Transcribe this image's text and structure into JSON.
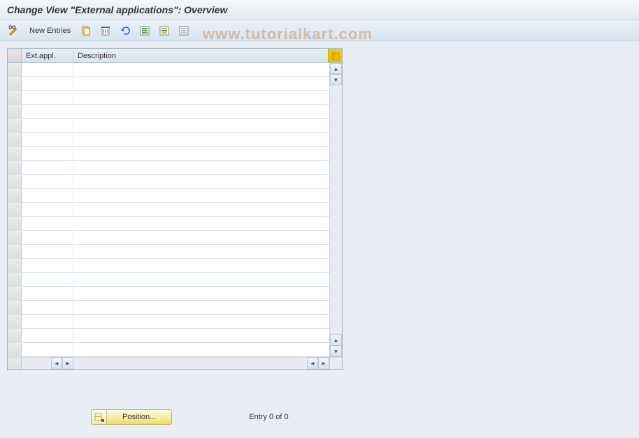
{
  "title": "Change View \"External applications\": Overview",
  "toolbar": {
    "new_entries_label": "New Entries"
  },
  "table": {
    "columns": {
      "col1": "Ext.appl.",
      "col2": "Description"
    },
    "row_count": 21
  },
  "footer": {
    "position_label": "Position...",
    "entry_text": "Entry 0 of 0"
  },
  "watermark": "www.tutorialkart.com"
}
